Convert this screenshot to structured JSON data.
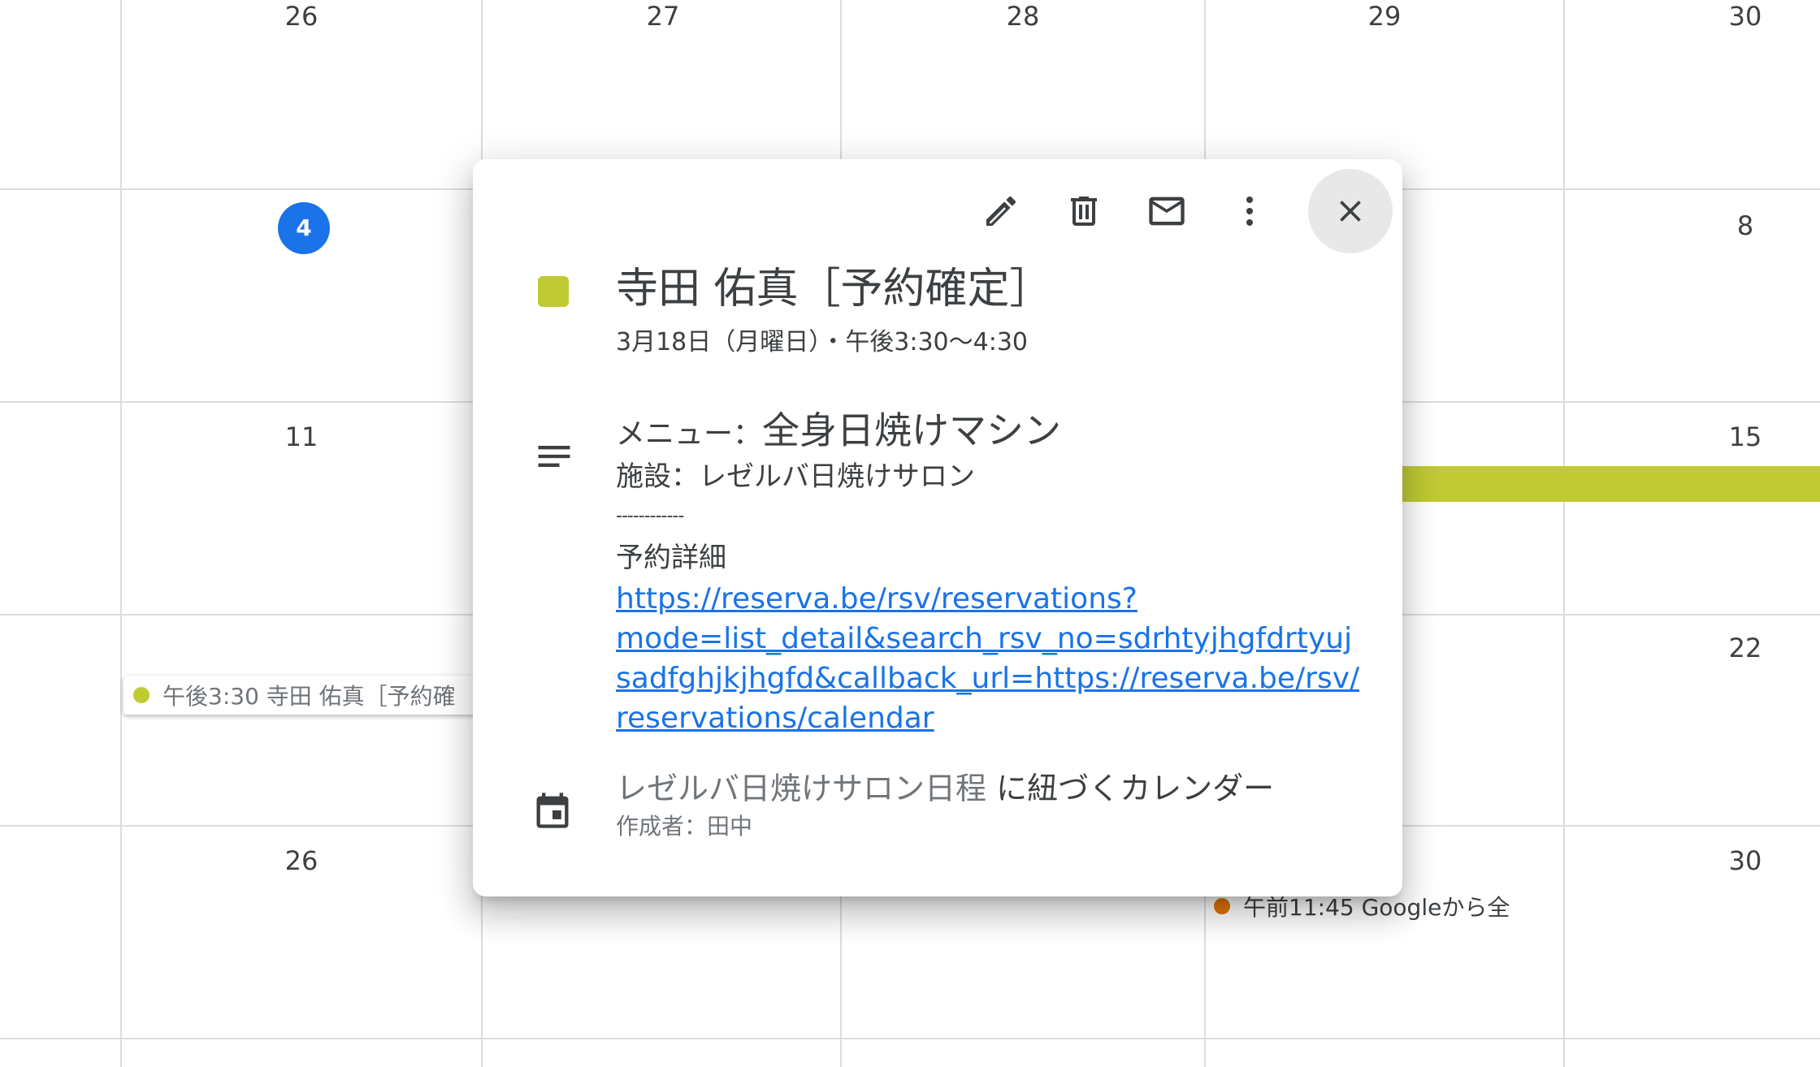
{
  "calendar": {
    "weeks": [
      [
        "26",
        "27",
        "28",
        "29",
        "30"
      ],
      [
        "4",
        "8"
      ],
      [
        "11",
        "15"
      ],
      [
        "22"
      ],
      [
        "26",
        "30"
      ]
    ],
    "today": "4",
    "events": [
      {
        "text": "午後3:30 寺田 佑真［予約確",
        "color": "#c0ca33"
      },
      {
        "text": "午前11:45 Googleから全",
        "color": "#e37400"
      }
    ],
    "multiday_bar_color": "#c0ca33"
  },
  "popup": {
    "toolbar": {
      "edit_icon": "pencil-icon",
      "delete_icon": "trash-icon",
      "email_icon": "mail-icon",
      "more_icon": "more-vert-icon",
      "close_icon": "close-icon"
    },
    "event_color": "#c0ca33",
    "title": "寺田 佑真［予約確定］",
    "datetime": "3月18日（月曜日）・午後3:30〜4:30",
    "description": {
      "menu_label": "メニュー：",
      "menu_value": "全身日焼けマシン",
      "facility": "施設：レゼルバ日焼けサロン",
      "divider": "------------",
      "detail_label": "予約詳細",
      "link_lines": [
        "https://reserva.be/rsv/reservations?",
        "mode=list_detail&search_rsv_no=sdrhtyjhgfdrtyuj",
        "sadfghjkjhgfd&callback_url=https://reserva.be/rsv/",
        "reservations/calendar"
      ]
    },
    "calendar_name": "レゼルバ日焼けサロン日程",
    "calendar_suffix": " に紐づくカレンダー",
    "creator": "作成者：田中"
  }
}
